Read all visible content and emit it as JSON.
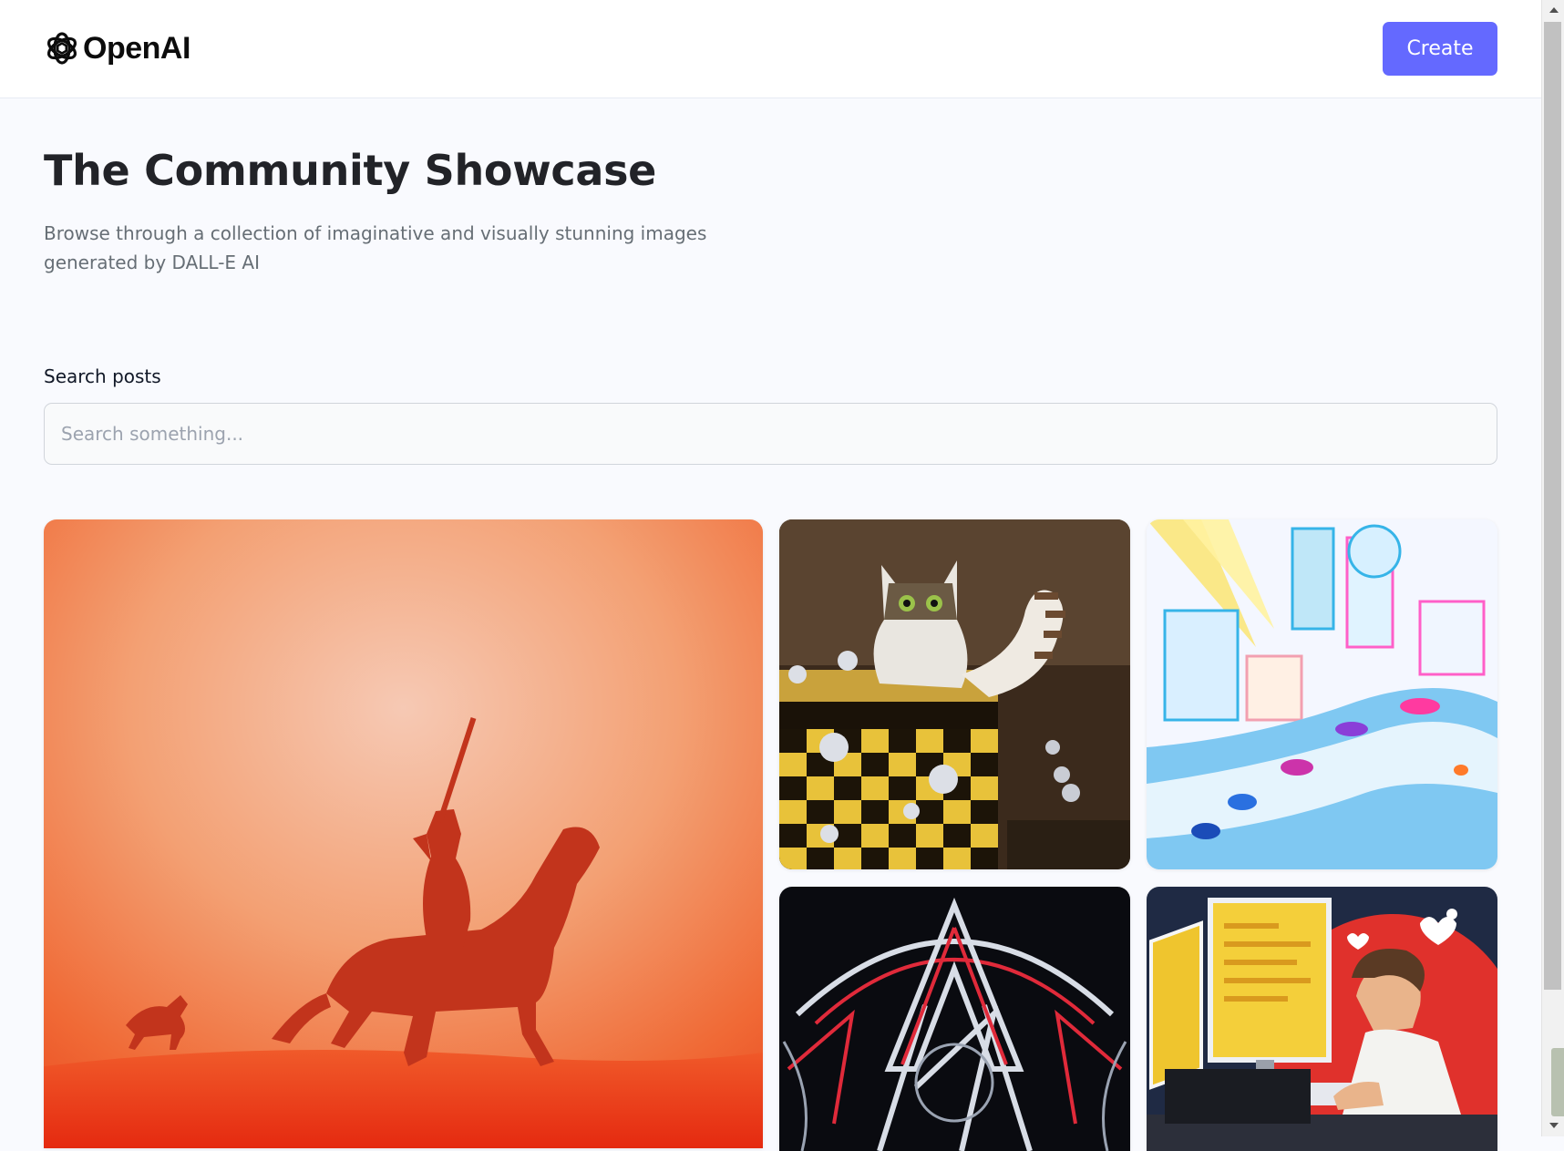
{
  "header": {
    "logo_text": "OpenAI",
    "logo_icon": "openai-logo-icon",
    "create_label": "Create"
  },
  "hero": {
    "title": "The Community Showcase",
    "subtitle": "Browse through a collection of imaginative and visually stunning images generated by DALL-E AI"
  },
  "search": {
    "label": "Search posts",
    "placeholder": "Search something...",
    "value": ""
  },
  "colors": {
    "accent": "#6469ff",
    "page_background": "#f9fafe",
    "title": "#222328",
    "subtitle": "#666e75"
  },
  "gallery": {
    "images": [
      "knight-on-horseback-red-haze",
      "cat-playing-chess-painting",
      "pastel-futuristic-city-highway",
      "neon-geometric-emblem",
      "programmer-at-computer-illustration"
    ]
  }
}
